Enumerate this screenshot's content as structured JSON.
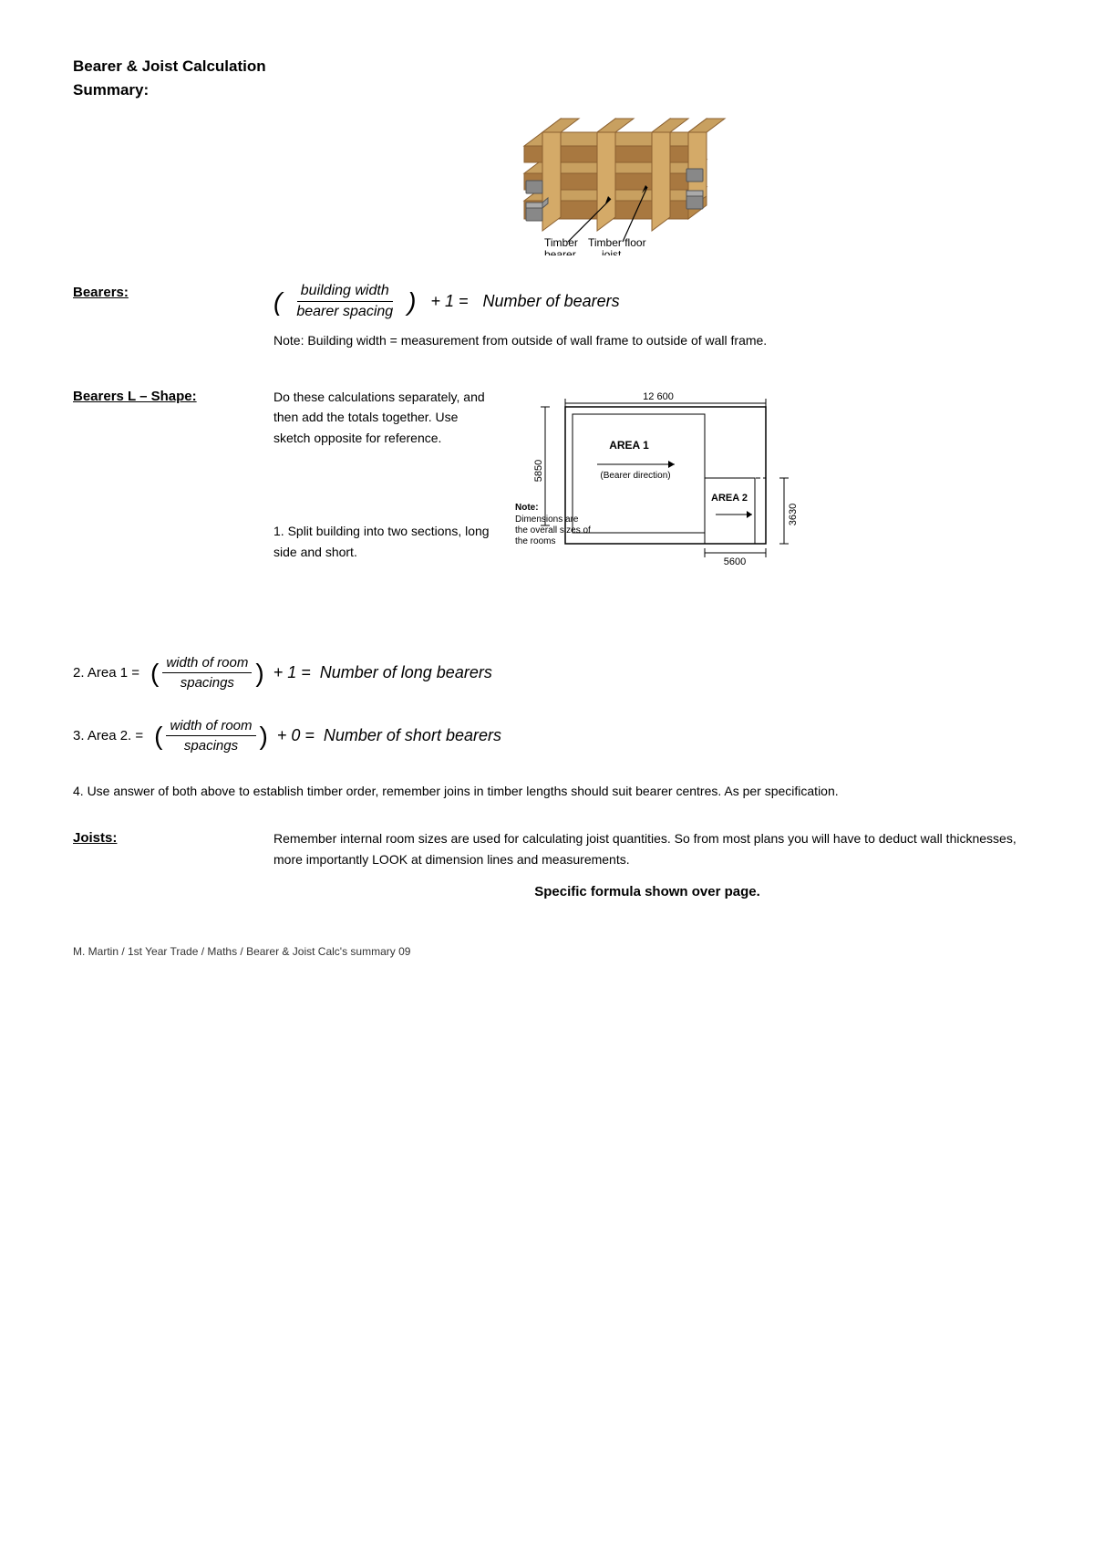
{
  "title": {
    "line1": "Bearer & Joist Calculation",
    "line2": "Summary:"
  },
  "bearers": {
    "label": "Bearers:",
    "formula": {
      "numerator": "building width",
      "denominator": "bearer spacing",
      "operator": "+ 1 =",
      "result": "Number of bearers"
    },
    "note": "Note:  Building width = measurement from outside of wall frame to outside of wall frame."
  },
  "bearers_l_shape": {
    "label": "Bearers L – Shape:",
    "description": "Do these calculations separately, and then add the totals together. Use sketch opposite for reference.",
    "step1": "1. Split building into two sections, long side and short.",
    "diagram": {
      "width_label": "12 600",
      "left_dim": "5850",
      "bottom_dim": "5600",
      "right_dim": "3630",
      "area1_label": "AREA 1",
      "area1_sub": "(Bearer direction)",
      "area2_label": "AREA 2",
      "note_label": "Note:",
      "note_text": "Dimensions are the overall sizes of the rooms"
    }
  },
  "area1_formula": {
    "label": "2. Area 1 =",
    "numerator": "width of room",
    "denominator": "spacings",
    "operator": "+  1 =",
    "result": "Number of long bearers"
  },
  "area2_formula": {
    "label": "3. Area 2. =",
    "numerator": "width of room",
    "denominator": "spacings",
    "operator": "+  0 =",
    "result": "Number of short bearers"
  },
  "step4": {
    "text": "4. Use answer of both above to establish timber order, remember joins in timber lengths should suit bearer centres. As per specification."
  },
  "joists": {
    "label": "Joists:",
    "text": "Remember internal room sizes are used for calculating joist quantities. So from most plans you will have to deduct wall thicknesses, more importantly LOOK at dimension lines and measurements.",
    "specific": "Specific formula shown over page."
  },
  "footer": {
    "text": "M. Martin / 1st Year Trade / Maths / Bearer & Joist Calc's summary 09"
  }
}
